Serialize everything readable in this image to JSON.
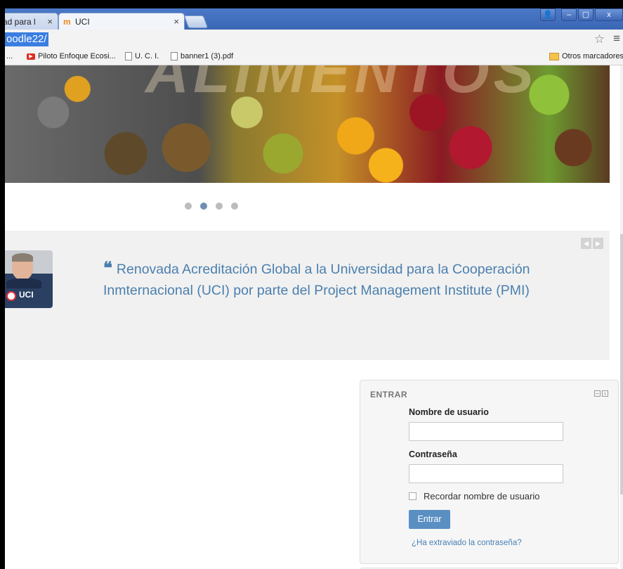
{
  "browser": {
    "tabs": [
      {
        "label": "ad para l",
        "active": false
      },
      {
        "label": "UCI",
        "active": true
      }
    ],
    "tab_close": "×",
    "url": "oodle22/",
    "bookmarks": [
      {
        "label": "...",
        "icon": "ellipsis"
      },
      {
        "label": "Piloto Enfoque Ecosi...",
        "icon": "youtube-icon"
      },
      {
        "label": "U. C. I.",
        "icon": "page-icon"
      },
      {
        "label": "banner1 (3).pdf",
        "icon": "page-icon"
      }
    ],
    "other_bookmarks": "Otros marcadores",
    "window_buttons": {
      "user": "👤",
      "minimize": "–",
      "maximize": "▢",
      "close": "x"
    }
  },
  "slider": {
    "banner_text": "ALIMENTOS",
    "dots": 4,
    "active_dot": 1
  },
  "news": {
    "image_text": "UCI",
    "quote_mark": "❝",
    "text": "Renovada Acreditación Global a la Universidad para la Cooperación Inmternacional (UCI) por parte del Project Management Institute (PMI)",
    "nav_prev": "◀",
    "nav_next": "▶"
  },
  "login": {
    "title": "ENTRAR",
    "username_label": "Nombre de usuario",
    "username_value": "",
    "password_label": "Contraseña",
    "password_value": "",
    "remember_label": "Recordar nombre de usuario",
    "submit_label": "Entrar",
    "forgot_label": "¿Ha extraviado la contraseña?"
  },
  "colors": {
    "accent": "#5a8fc2",
    "link": "#4a80b5",
    "news_text": "#4b7fae",
    "chrome_blue": "#3a66b5"
  }
}
